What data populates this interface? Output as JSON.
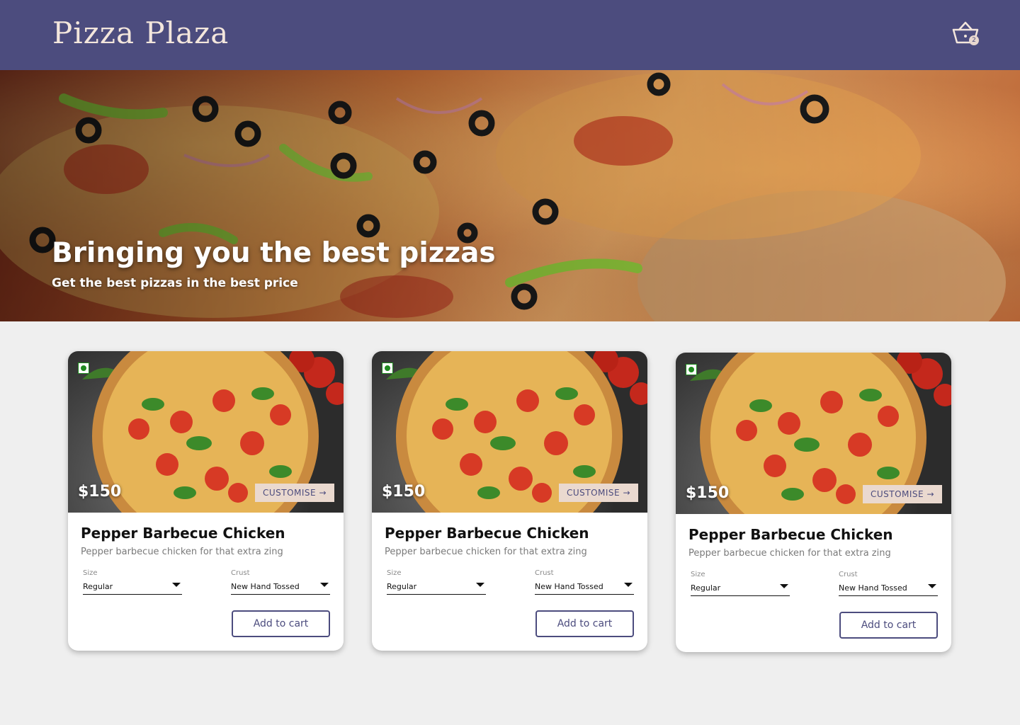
{
  "header": {
    "brand": "Pizza Plaza",
    "cart_count": "2"
  },
  "hero": {
    "title": "Bringing you the best pizzas",
    "subtitle": "Get the best pizzas in the best price"
  },
  "colors": {
    "brand": "#4c4c7e",
    "accent": "#ead9cf",
    "veg": "#1f8a1f"
  },
  "products": [
    {
      "price": "$150",
      "customise_label": "CUSTOMISE →",
      "name": "Pepper Barbecue Chicken",
      "description": "Pepper barbecue chicken for that extra zing",
      "size_label": "Size",
      "size_value": "Regular",
      "crust_label": "Crust",
      "crust_value": "New Hand Tossed",
      "add_label": "Add to cart"
    },
    {
      "price": "$150",
      "customise_label": "CUSTOMISE →",
      "name": "Pepper Barbecue Chicken",
      "description": "Pepper barbecue chicken for that extra zing",
      "size_label": "Size",
      "size_value": "Regular",
      "crust_label": "Crust",
      "crust_value": "New Hand Tossed",
      "add_label": "Add to cart"
    },
    {
      "price": "$150",
      "customise_label": "CUSTOMISE →",
      "name": "Pepper Barbecue Chicken",
      "description": "Pepper barbecue chicken for that extra zing",
      "size_label": "Size",
      "size_value": "Regular",
      "crust_label": "Crust",
      "crust_value": "New Hand Tossed",
      "add_label": "Add to cart"
    }
  ]
}
